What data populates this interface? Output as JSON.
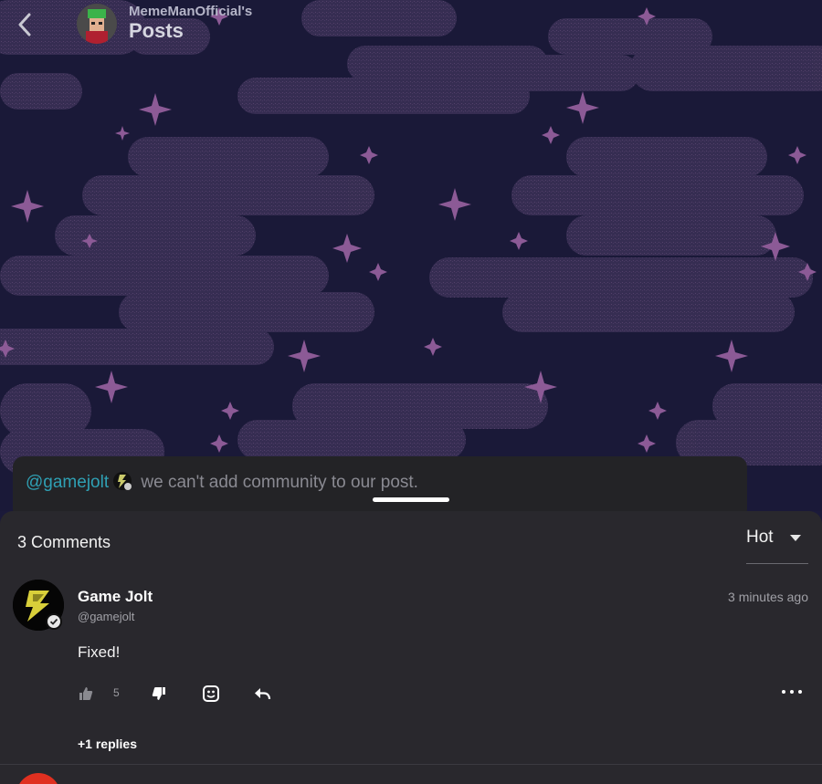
{
  "header": {
    "owner": "MemeManOfficial's",
    "title": "Posts",
    "back_icon": "chevron-left-icon"
  },
  "post": {
    "mention": "@gamejolt",
    "text": "we can't add community to our post."
  },
  "comments": {
    "count_label": "3 Comments",
    "sort_label": "Hot",
    "items": [
      {
        "author": "Game Jolt",
        "handle": "@gamejolt",
        "time": "3 minutes ago",
        "body": "Fixed!",
        "likes": "5",
        "replies_label": "+1 replies"
      }
    ]
  },
  "colors": {
    "background": "#191838",
    "sheet": "#29282d",
    "mention": "#2fa0b4",
    "star": "#7a4f86"
  }
}
